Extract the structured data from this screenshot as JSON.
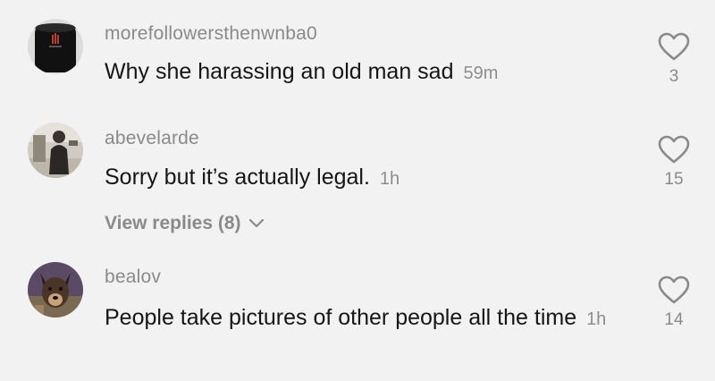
{
  "comments": [
    {
      "username": "morefollowersthenwnba0",
      "text": "Why she harassing an old man sad",
      "time": "59m",
      "likes": "3",
      "avatar_icon": "black-speaker-avatar"
    },
    {
      "username": "abevelarde",
      "text": "Sorry but it’s actually legal.",
      "time": "1h",
      "likes": "15",
      "avatar_icon": "person-photo-avatar",
      "view_replies_label": "View replies (8)"
    },
    {
      "username": "bealov",
      "text": "People take pictures of other people all the time",
      "time": "1h",
      "likes": "14",
      "avatar_icon": "dog-photo-avatar"
    }
  ],
  "colors": {
    "background": "#f2f2f2",
    "username": "#8a8a8a",
    "text": "#161616"
  }
}
